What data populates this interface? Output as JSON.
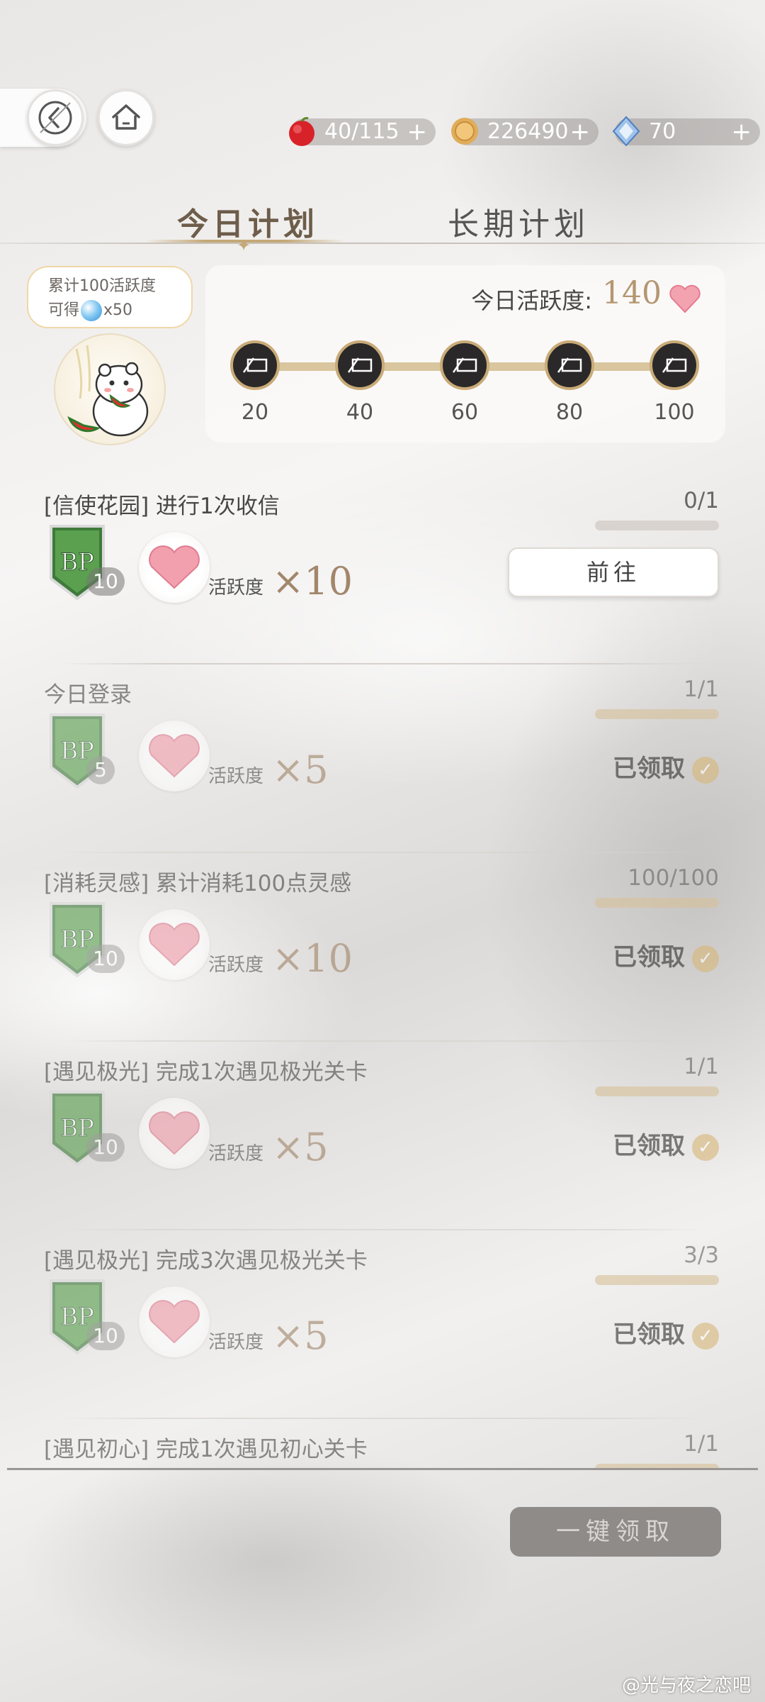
{
  "header": {
    "resources": {
      "stamina": "40/115",
      "gold": "226490",
      "gems": "70",
      "plus": "+"
    }
  },
  "tabs": [
    {
      "label": "今日计划",
      "active": true
    },
    {
      "label": "长期计划",
      "active": false
    }
  ],
  "bubble": {
    "line1": "累计100活跃度",
    "line2_prefix": "可得",
    "line2_suffix": "x50"
  },
  "activity": {
    "label": "今日活跃度:",
    "value": "140",
    "milestones": [
      "20",
      "40",
      "60",
      "80",
      "100"
    ]
  },
  "tasks": [
    {
      "title": "[信使花园] 进行1次收信",
      "progress": "0/1",
      "fill": 0,
      "bp": "10",
      "reward_label": "活跃度",
      "reward_value": "×10",
      "action": "前往",
      "done": false
    },
    {
      "title": "今日登录",
      "progress": "1/1",
      "fill": 1,
      "bp": "5",
      "reward_label": "活跃度",
      "reward_value": "×5",
      "action": "已领取",
      "done": true
    },
    {
      "title": "[消耗灵感] 累计消耗100点灵感",
      "progress": "100/100",
      "fill": 1,
      "bp": "10",
      "reward_label": "活跃度",
      "reward_value": "×10",
      "action": "已领取",
      "done": true
    },
    {
      "title": "[遇见极光] 完成1次遇见极光关卡",
      "progress": "1/1",
      "fill": 1,
      "bp": "10",
      "reward_label": "活跃度",
      "reward_value": "×5",
      "action": "已领取",
      "done": true
    },
    {
      "title": "[遇见极光] 完成3次遇见极光关卡",
      "progress": "3/3",
      "fill": 1,
      "bp": "10",
      "reward_label": "活跃度",
      "reward_value": "×5",
      "action": "已领取",
      "done": true
    },
    {
      "title": "[遇见初心] 完成1次遇见初心关卡",
      "progress": "1/1",
      "fill": 1,
      "done": true
    }
  ],
  "claim_all": "一键领取",
  "watermark": "@光与夜之恋吧",
  "colors": {
    "accent_gold": "#c4a878",
    "claimed_check": "#d7b77a",
    "bp_green": "#3f7a3b"
  }
}
